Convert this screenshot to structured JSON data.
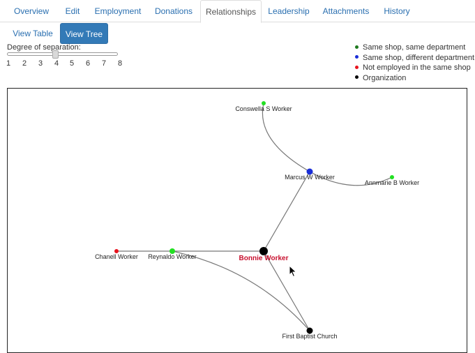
{
  "tabs": [
    {
      "label": "Overview"
    },
    {
      "label": "Edit"
    },
    {
      "label": "Employment"
    },
    {
      "label": "Donations"
    },
    {
      "label": "Relationships"
    },
    {
      "label": "Leadership"
    },
    {
      "label": "Attachments"
    },
    {
      "label": "History"
    }
  ],
  "active_tab": "Relationships",
  "view_buttons": {
    "table": "View Table",
    "tree": "View Tree"
  },
  "separation": {
    "label": "Degree of separation:",
    "ticks": [
      "1",
      "2",
      "3",
      "4",
      "5",
      "6",
      "7",
      "8"
    ],
    "value": 4
  },
  "legend": [
    {
      "label": "Same shop, same department",
      "color": "#1f7a1f"
    },
    {
      "label": "Same shop, different department",
      "color": "#1a2ed8"
    },
    {
      "label": "Not employed in the same shop",
      "color": "#e8141e"
    },
    {
      "label": "Organization",
      "color": "#000000"
    }
  ],
  "graph": {
    "nodes": [
      {
        "id": "bonnie",
        "label": "Bonnie Worker",
        "color": "#000000",
        "focus": true
      },
      {
        "id": "marcus",
        "label": "Marcus W Worker",
        "color": "#1a2ed8"
      },
      {
        "id": "conswella",
        "label": "Conswella S Worker",
        "color": "#22e022"
      },
      {
        "id": "annmarie",
        "label": "Annmarie B Worker",
        "color": "#22e022"
      },
      {
        "id": "reynaldo",
        "label": "Reynaldo Worker",
        "color": "#22e022"
      },
      {
        "id": "chanell",
        "label": "Chanell Worker",
        "color": "#e8141e"
      },
      {
        "id": "church",
        "label": "First Baptist Church",
        "color": "#000000"
      }
    ],
    "edges": [
      [
        "bonnie",
        "marcus"
      ],
      [
        "marcus",
        "conswella"
      ],
      [
        "marcus",
        "annmarie"
      ],
      [
        "bonnie",
        "reynaldo"
      ],
      [
        "reynaldo",
        "chanell"
      ],
      [
        "bonnie",
        "church"
      ],
      [
        "reynaldo",
        "church"
      ]
    ]
  }
}
